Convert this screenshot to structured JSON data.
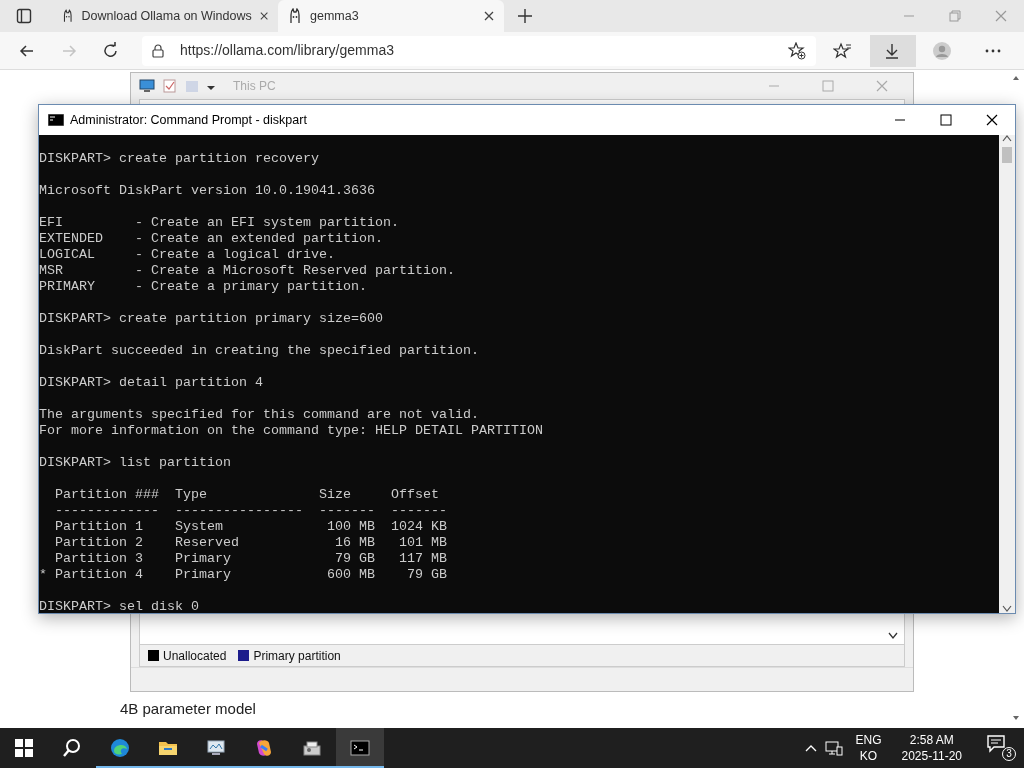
{
  "browser": {
    "tabs": [
      {
        "label": "Download Ollama on Windows",
        "selected": false
      },
      {
        "label": "gemma3",
        "selected": true
      }
    ],
    "nav": [
      {
        "kind": "back",
        "disabled": false
      },
      {
        "kind": "forward",
        "disabled": true
      },
      {
        "kind": "refresh",
        "disabled": false
      }
    ],
    "url": "https://ollama.com/library/gemma3",
    "page_text": "4B parameter model"
  },
  "disk_window": {
    "title": "This PC",
    "legend": [
      {
        "label": "Unallocated",
        "color": "#000000"
      },
      {
        "label": "Primary partition",
        "color": "#1c1c8c"
      }
    ]
  },
  "cmd_window": {
    "title": "Administrator: Command Prompt - diskpart",
    "blocks": [
      [
        "DISKPART> create partition recovery"
      ],
      [
        "Microsoft DiskPart version 10.0.19041.3636"
      ],
      [
        "EFI         - Create an EFI system partition.",
        "EXTENDED    - Create an extended partition.",
        "LOGICAL     - Create a logical drive.",
        "MSR         - Create a Microsoft Reserved partition.",
        "PRIMARY     - Create a primary partition."
      ],
      [
        "DISKPART> create partition primary size=600"
      ],
      [
        "DiskPart succeeded in creating the specified partition."
      ],
      [
        "DISKPART> detail partition 4"
      ],
      [
        "The arguments specified for this command are not valid.",
        "For more information on the command type: HELP DETAIL PARTITION"
      ],
      [
        "DISKPART> list partition"
      ],
      [
        "  Partition ###  Type              Size     Offset",
        "  -------------  ----------------  -------  -------",
        "  Partition 1    System             100 MB  1024 KB",
        "  Partition 2    Reserved            16 MB   101 MB",
        "  Partition 3    Primary             79 GB   117 MB",
        "* Partition 4    Primary            600 MB    79 GB"
      ],
      [
        "DISKPART> sel disk 0"
      ]
    ]
  },
  "taskbar": {
    "apps": [
      {
        "kind": "start",
        "running": false,
        "selected": false
      },
      {
        "kind": "search",
        "running": false,
        "selected": false
      },
      {
        "kind": "edge",
        "running": true,
        "selected": false
      },
      {
        "kind": "explorer",
        "running": true,
        "selected": false
      },
      {
        "kind": "monitor",
        "running": true,
        "selected": false
      },
      {
        "kind": "copilot",
        "running": true,
        "selected": false
      },
      {
        "kind": "tool",
        "running": true,
        "selected": false
      },
      {
        "kind": "terminal",
        "running": true,
        "selected": true
      }
    ],
    "lang": "ENG",
    "ime": "KO",
    "time": "2:58 AM",
    "date": "2025-11-20",
    "notifications": "3"
  }
}
